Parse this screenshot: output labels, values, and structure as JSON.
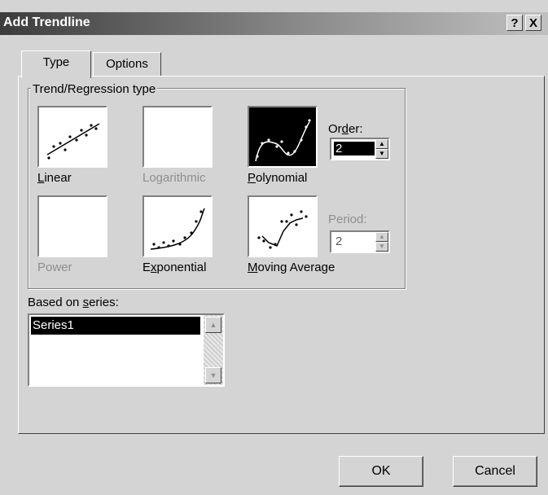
{
  "dialog": {
    "title": "Add Trendline",
    "help_label": "?",
    "close_label": "X"
  },
  "tabs": [
    {
      "label": "Type",
      "active": true
    },
    {
      "label": "Options",
      "active": false
    }
  ],
  "trend_group": {
    "label": "Trend/Regression type",
    "types": [
      {
        "prefix": "",
        "accel": "L",
        "rest": "inear",
        "enabled": true,
        "selected": false,
        "icon": "linear-chart-icon"
      },
      {
        "prefix": "",
        "accel": "",
        "rest": "Logarithmic",
        "enabled": false,
        "selected": false,
        "icon": "blank-chart-icon"
      },
      {
        "prefix": "",
        "accel": "P",
        "rest": "olynomial",
        "enabled": true,
        "selected": true,
        "icon": "polynomial-chart-icon"
      },
      {
        "prefix": "",
        "accel": "",
        "rest": "Power",
        "enabled": false,
        "selected": false,
        "icon": "blank-chart-icon"
      },
      {
        "prefix": "E",
        "accel": "x",
        "rest": "ponential",
        "enabled": true,
        "selected": false,
        "icon": "exponential-chart-icon"
      },
      {
        "prefix": "",
        "accel": "M",
        "rest": "oving Average",
        "enabled": true,
        "selected": false,
        "icon": "moving-average-chart-icon"
      }
    ],
    "order": {
      "label_prefix": "Or",
      "label_accel": "d",
      "label_rest": "er:",
      "value": "2"
    },
    "period": {
      "label": "Period:",
      "value": "2"
    }
  },
  "series": {
    "label_prefix": "Based on ",
    "label_accel": "s",
    "label_rest": "eries:",
    "items": [
      "Series1"
    ],
    "selected": "Series1"
  },
  "buttons": {
    "ok": "OK",
    "cancel": "Cancel"
  }
}
